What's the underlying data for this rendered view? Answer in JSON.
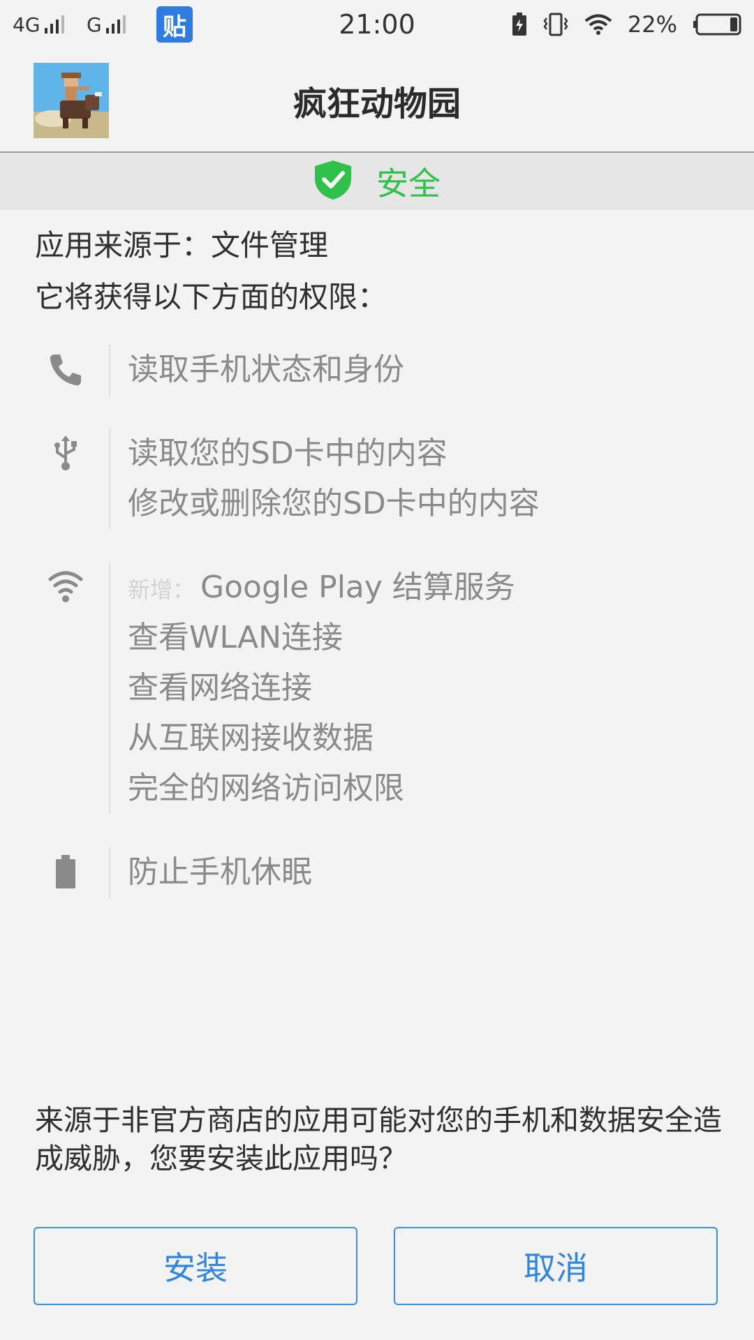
{
  "status_bar": {
    "network_1": "4G",
    "network_2": "G",
    "tieba_badge": "贴",
    "time": "21:00",
    "battery_percent": "22%",
    "icons": [
      "signal-icon",
      "tieba-icon",
      "battery-saver-icon",
      "vibrate-icon",
      "wifi-icon",
      "battery-icon"
    ]
  },
  "header": {
    "app_name": "疯狂动物园",
    "icon": "app-icon"
  },
  "safety": {
    "label": "安全",
    "icon": "shield-check-icon",
    "color": "#2fc14a"
  },
  "source_line": "应用来源于：文件管理",
  "intro_line": "它将获得以下方面的权限：",
  "permissions": [
    {
      "icon": "phone-icon",
      "lines": [
        "读取手机状态和身份"
      ]
    },
    {
      "icon": "usb-icon",
      "lines": [
        "读取您的SD卡中的内容",
        "修改或删除您的SD卡中的内容"
      ]
    },
    {
      "icon": "wifi-icon",
      "new_tag": "新增：",
      "lines": [
        "Google Play 结算服务",
        "查看WLAN连接",
        "查看网络连接",
        "从互联网接收数据",
        "完全的网络访问权限"
      ]
    },
    {
      "icon": "battery-icon",
      "lines": [
        "防止手机休眠"
      ]
    }
  ],
  "warning": "来源于非官方商店的应用可能对您的手机和数据安全造成威胁，您要安装此应用吗？",
  "buttons": {
    "install": "安装",
    "cancel": "取消"
  },
  "colors": {
    "accent": "#2f86dc",
    "safe": "#2fc14a",
    "background": "#f3f3f3"
  }
}
